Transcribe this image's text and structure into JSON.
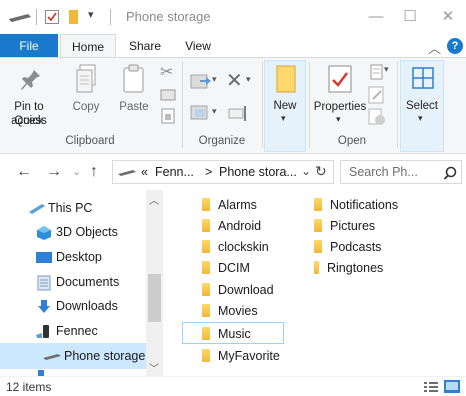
{
  "window": {
    "title": "Phone storage",
    "controls": [
      "minimize",
      "maximize",
      "close"
    ]
  },
  "ribbon": {
    "tabs": [
      {
        "label": "File"
      },
      {
        "label": "Home"
      },
      {
        "label": "Share"
      },
      {
        "label": "View"
      }
    ],
    "clipboard": {
      "pin_label_1": "Pin to Quick",
      "pin_label_2": "access",
      "copy_label": "Copy",
      "paste_label": "Paste",
      "group_label": "Clipboard"
    },
    "organize": {
      "group_label": "Organize"
    },
    "new": {
      "label": "New"
    },
    "open": {
      "properties_label": "Properties",
      "group_label": "Open"
    },
    "select": {
      "label": "Select"
    }
  },
  "address": {
    "parts": [
      "«",
      "Fenn...",
      ">",
      "Phone stora..."
    ]
  },
  "search": {
    "placeholder": "Search Ph..."
  },
  "nav_pane": {
    "items": [
      {
        "label": "This PC",
        "icon": "computer-icon"
      },
      {
        "label": "3D Objects",
        "icon": "cube-icon"
      },
      {
        "label": "Desktop",
        "icon": "desktop-icon"
      },
      {
        "label": "Documents",
        "icon": "document-icon"
      },
      {
        "label": "Downloads",
        "icon": "download-icon"
      },
      {
        "label": "Fennec",
        "icon": "phone-icon"
      },
      {
        "label": "Phone storage",
        "icon": "drive-icon"
      }
    ]
  },
  "files": {
    "col1": [
      "Alarms",
      "Android",
      "clockskin",
      "DCIM",
      "Download",
      "Movies",
      "Music",
      "MyFavorite"
    ],
    "col2": [
      "Notifications",
      "Pictures",
      "Podcasts",
      "Ringtones"
    ]
  },
  "status": {
    "count": "12 items"
  },
  "colors": {
    "accent": "#1979ca",
    "selection": "#cce8ff",
    "folder": "#f1b83a"
  }
}
